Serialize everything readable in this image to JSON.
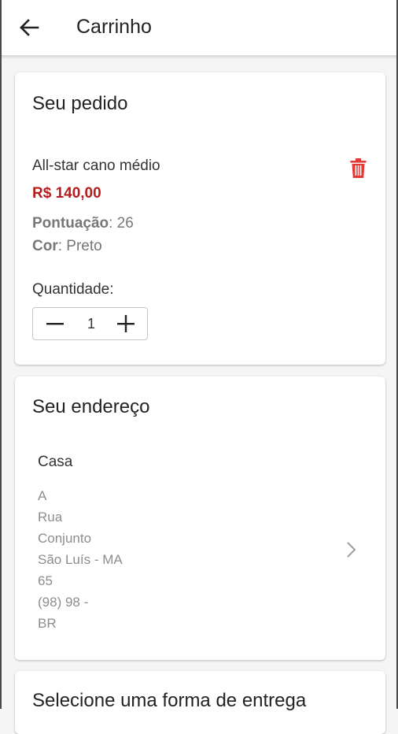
{
  "header": {
    "back_icon": "arrow-left-icon",
    "title": "Carrinho"
  },
  "order": {
    "title": "Seu pedido",
    "item": {
      "name": "All-star cano médio",
      "price": "R$ 140,00",
      "score_label": "Pontuação",
      "score_value": ": 26",
      "color_label": "Cor",
      "color_value": ": Preto",
      "delete_icon": "trash-icon"
    },
    "quantity": {
      "label": "Quantidade:",
      "value": "1",
      "minus_icon": "minus-icon",
      "plus_icon": "plus-icon"
    }
  },
  "address": {
    "title": "Seu endereço",
    "name": "Casa",
    "lines": [
      "A",
      "Rua",
      "Conjunto",
      "São Luís - MA",
      "65",
      "(98) 98   -",
      "BR"
    ],
    "chevron_icon": "chevron-right-icon"
  },
  "delivery": {
    "title": "Selecione uma forma de entrega"
  },
  "colors": {
    "price": "#b71c1c",
    "delete_icon": "#e53935",
    "muted_text": "#8d8d8d",
    "background": "#f5f5f5"
  }
}
